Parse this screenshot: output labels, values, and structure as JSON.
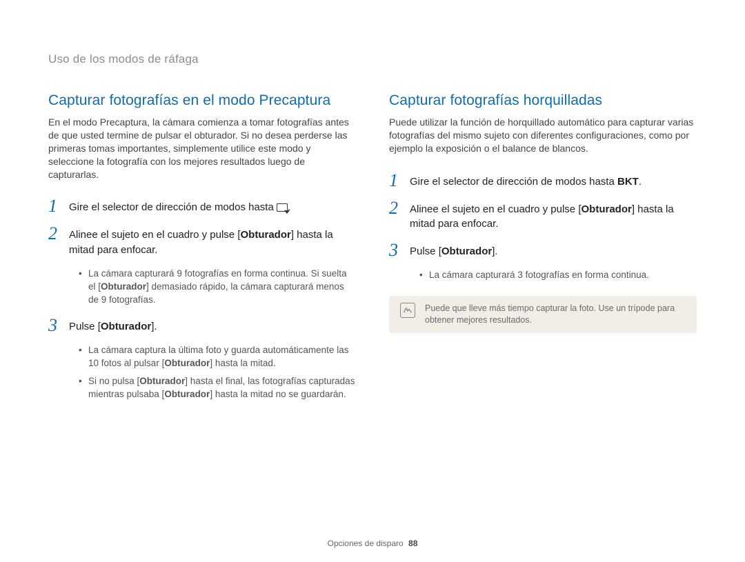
{
  "breadcrumb": "Uso de los modos de ráfaga",
  "left": {
    "heading": "Capturar fotografías en el modo Precaptura",
    "intro": "En el modo Precaptura, la cámara comienza a tomar fotografías antes de que usted termine de pulsar el obturador. Si no desea perderse las primeras tomas importantes, simplemente utilice este modo y seleccione la fotografía con los mejores resultados luego de capturarlas.",
    "step1_pre": "Gire el selector de dirección de modos hasta ",
    "step1_post": ".",
    "step2_a": "Alinee el sujeto en el cuadro y pulse [",
    "step2_b": "] hasta la mitad para enfocar.",
    "step2_sub_a": "La cámara capturará 9 fotografías en forma continua. Si suelta el [",
    "step2_sub_b": "] demasiado rápido, la cámara capturará menos de 9 fotografías.",
    "step3_a": "Pulse [",
    "step3_b": "].",
    "step3_sub1_a": "La cámara captura la última foto y guarda automáticamente las 10 fotos al pulsar [",
    "step3_sub1_b": "] hasta la mitad.",
    "step3_sub2_a": "Si no pulsa [",
    "step3_sub2_b": "] hasta el final, las fotografías capturadas mientras pulsaba [",
    "step3_sub2_c": "] hasta la mitad no se guardarán."
  },
  "right": {
    "heading": "Capturar fotografías horquilladas",
    "intro": "Puede utilizar la función de horquillado automático para capturar varias fotografías del mismo sujeto con diferentes configuraciones, como por ejemplo la exposición o el balance de blancos.",
    "step1_a": "Gire el selector de dirección de modos hasta ",
    "step1_b": ".",
    "bkt": "BKT",
    "step2_a": "Alinee el sujeto en el cuadro y pulse [",
    "step2_b": "] hasta la mitad para enfocar.",
    "step3_a": "Pulse [",
    "step3_b": "].",
    "step3_sub": "La cámara capturará 3 fotografías en forma continua.",
    "note": "Puede que lleve más tiempo capturar la foto. Use un trípode para obtener mejores resultados."
  },
  "shutter": "Obturador",
  "footer_label": "Opciones de disparo",
  "footer_page": "88"
}
